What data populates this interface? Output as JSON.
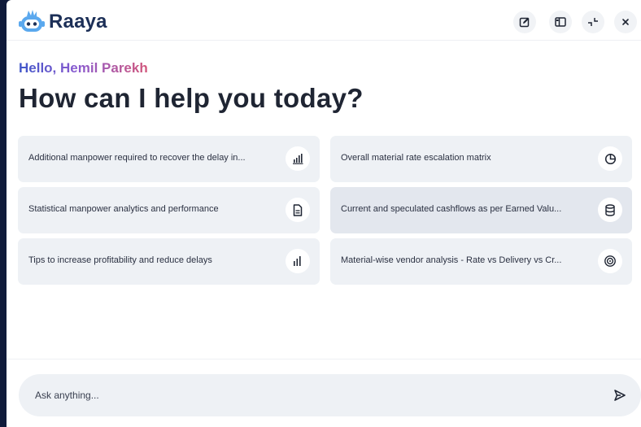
{
  "app": {
    "brand": "Raaya",
    "logo_icon": "robot-mascot-icon"
  },
  "header": {
    "buttons": [
      {
        "name": "new-chat",
        "icon": "edit-icon"
      },
      {
        "name": "layout",
        "icon": "panel-layout-icon"
      },
      {
        "name": "collapse",
        "icon": "collapse-icon"
      },
      {
        "name": "close",
        "icon": "close-icon"
      }
    ]
  },
  "main": {
    "greeting": "Hello, Hemil Parekh",
    "headline": "How can I help you today?",
    "suggestions": [
      {
        "label": "Additional manpower required to recover the delay in...",
        "icon": "bar-chart-icon"
      },
      {
        "label": "Overall material rate escalation matrix",
        "icon": "pie-chart-icon"
      },
      {
        "label": "Statistical manpower analytics and performance",
        "icon": "document-icon"
      },
      {
        "label": "Current and speculated cashflows as per Earned Valu...",
        "icon": "database-icon"
      },
      {
        "label": "Tips to increase profitability and reduce delays",
        "icon": "bar-chart-icon"
      },
      {
        "label": "Material-wise vendor analysis - Rate vs Delivery vs Cr...",
        "icon": "target-icon"
      }
    ]
  },
  "composer": {
    "placeholder": "Ask anything...",
    "send_icon": "send-icon"
  },
  "colors": {
    "brand": "#1c2f57",
    "background": "#0f1a3a",
    "card": "#eef1f5"
  }
}
